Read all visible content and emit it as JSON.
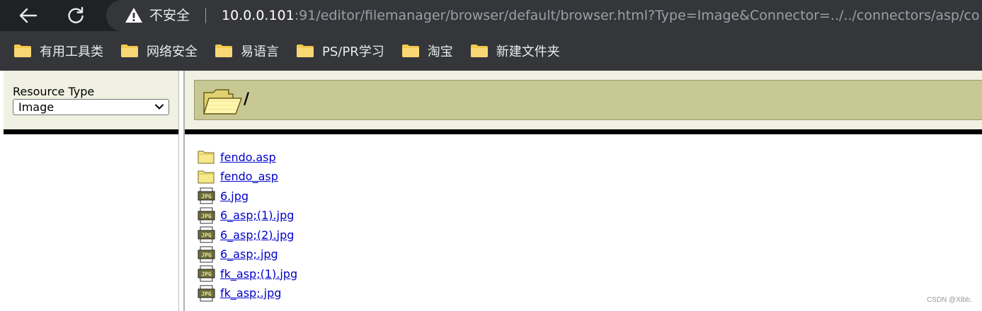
{
  "browser": {
    "security_label": "不安全",
    "url_host": "10.0.0.101",
    "url_rest": ":91/editor/filemanager/browser/default/browser.html?Type=Image&Connector=../../connectors/asp/co..."
  },
  "bookmarks": [
    {
      "label": "有用工具类"
    },
    {
      "label": "网络安全"
    },
    {
      "label": "易语言"
    },
    {
      "label": "PS/PR学习"
    },
    {
      "label": "淘宝"
    },
    {
      "label": "新建文件夹"
    }
  ],
  "left_panel": {
    "resource_type_label": "Resource Type",
    "resource_type_value": "Image"
  },
  "path_bar": {
    "current_path": "/"
  },
  "files": [
    {
      "name": "fendo.asp",
      "icon": "folder-icon"
    },
    {
      "name": "fendo_asp",
      "icon": "folder-icon"
    },
    {
      "name": "6.jpg",
      "icon": "jpg-file-icon"
    },
    {
      "name": "6_asp;(1).jpg",
      "icon": "jpg-file-icon"
    },
    {
      "name": "6_asp;(2).jpg",
      "icon": "jpg-file-icon"
    },
    {
      "name": "6_asp;.jpg",
      "icon": "jpg-file-icon"
    },
    {
      "name": "fk_asp;(1).jpg",
      "icon": "jpg-file-icon"
    },
    {
      "name": "fk_asp;.jpg",
      "icon": "jpg-file-icon"
    }
  ],
  "watermark": "CSDN @Xlbb.",
  "colors": {
    "chrome_dark": "#202124",
    "chrome_bar": "#35363a",
    "panel_bg": "#f0f0e3",
    "path_bar": "#c8c894",
    "link": "#0000cc"
  }
}
